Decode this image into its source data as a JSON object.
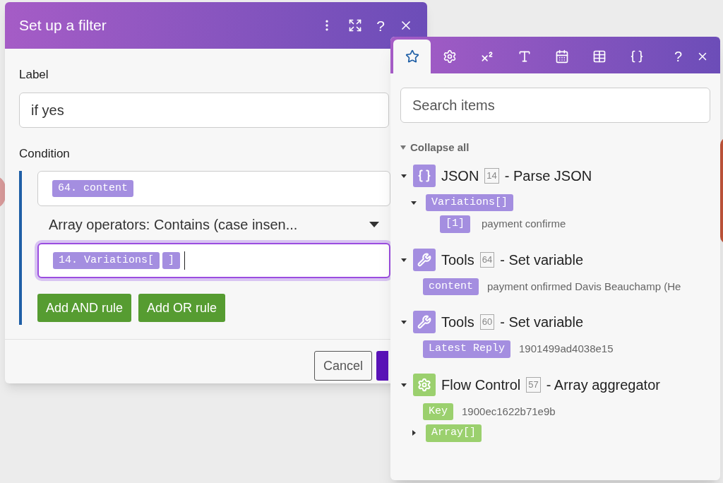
{
  "dialog": {
    "title": "Set up a filter",
    "help": "?",
    "label_caption": "Label",
    "label_value": "if yes",
    "condition_caption": "Condition",
    "condition": {
      "operand_a": [
        {
          "text": "64. content"
        }
      ],
      "operator": "Array operators: Contains (case insen...",
      "operand_b": [
        {
          "text": "14. Variations["
        },
        {
          "text": "]"
        }
      ],
      "focused": true
    },
    "rule_buttons": [
      "Add AND rule",
      "Add OR rule"
    ],
    "cancel": "Cancel"
  },
  "panel": {
    "help": "?",
    "tabs": [
      {
        "kind": "star",
        "selected": true
      },
      {
        "kind": "gear",
        "selected": false
      },
      {
        "kind": "superscript",
        "selected": false
      },
      {
        "kind": "text",
        "selected": false
      },
      {
        "kind": "calendar",
        "selected": false
      },
      {
        "kind": "table",
        "selected": false
      },
      {
        "kind": "braces",
        "selected": false
      }
    ],
    "search": {
      "placeholder": "Search items"
    },
    "collapse_all": "Collapse all",
    "modules": [
      {
        "kind": "json",
        "color": "#a48ee0",
        "name": "JSON",
        "number": "14",
        "action": "- Parse JSON",
        "expanded": true,
        "items": [
          {
            "label": "Variations[]",
            "expanded": true,
            "children": [
              {
                "label": "[1]",
                "value": "payment confirme"
              }
            ]
          }
        ]
      },
      {
        "kind": "tools",
        "color": "#a48ee0",
        "name": "Tools",
        "number": "64",
        "action": "- Set variable",
        "expanded": true,
        "items": [
          {
            "label": "content",
            "value": "payment onfirmed Davis Beauchamp (He"
          }
        ]
      },
      {
        "kind": "tools",
        "color": "#a48ee0",
        "name": "Tools",
        "number": "60",
        "action": "- Set variable",
        "expanded": true,
        "items": [
          {
            "label": "Latest Reply",
            "value": "1901499ad4038e15"
          }
        ]
      },
      {
        "kind": "flow",
        "color": "#9bd06e",
        "name": "Flow Control",
        "number": "57",
        "action": "- Array aggregator",
        "expanded": true,
        "items": [
          {
            "label": "Key",
            "value": "1900ec1622b71e9b"
          },
          {
            "label": "Array[]",
            "expanded": false
          }
        ]
      }
    ]
  }
}
